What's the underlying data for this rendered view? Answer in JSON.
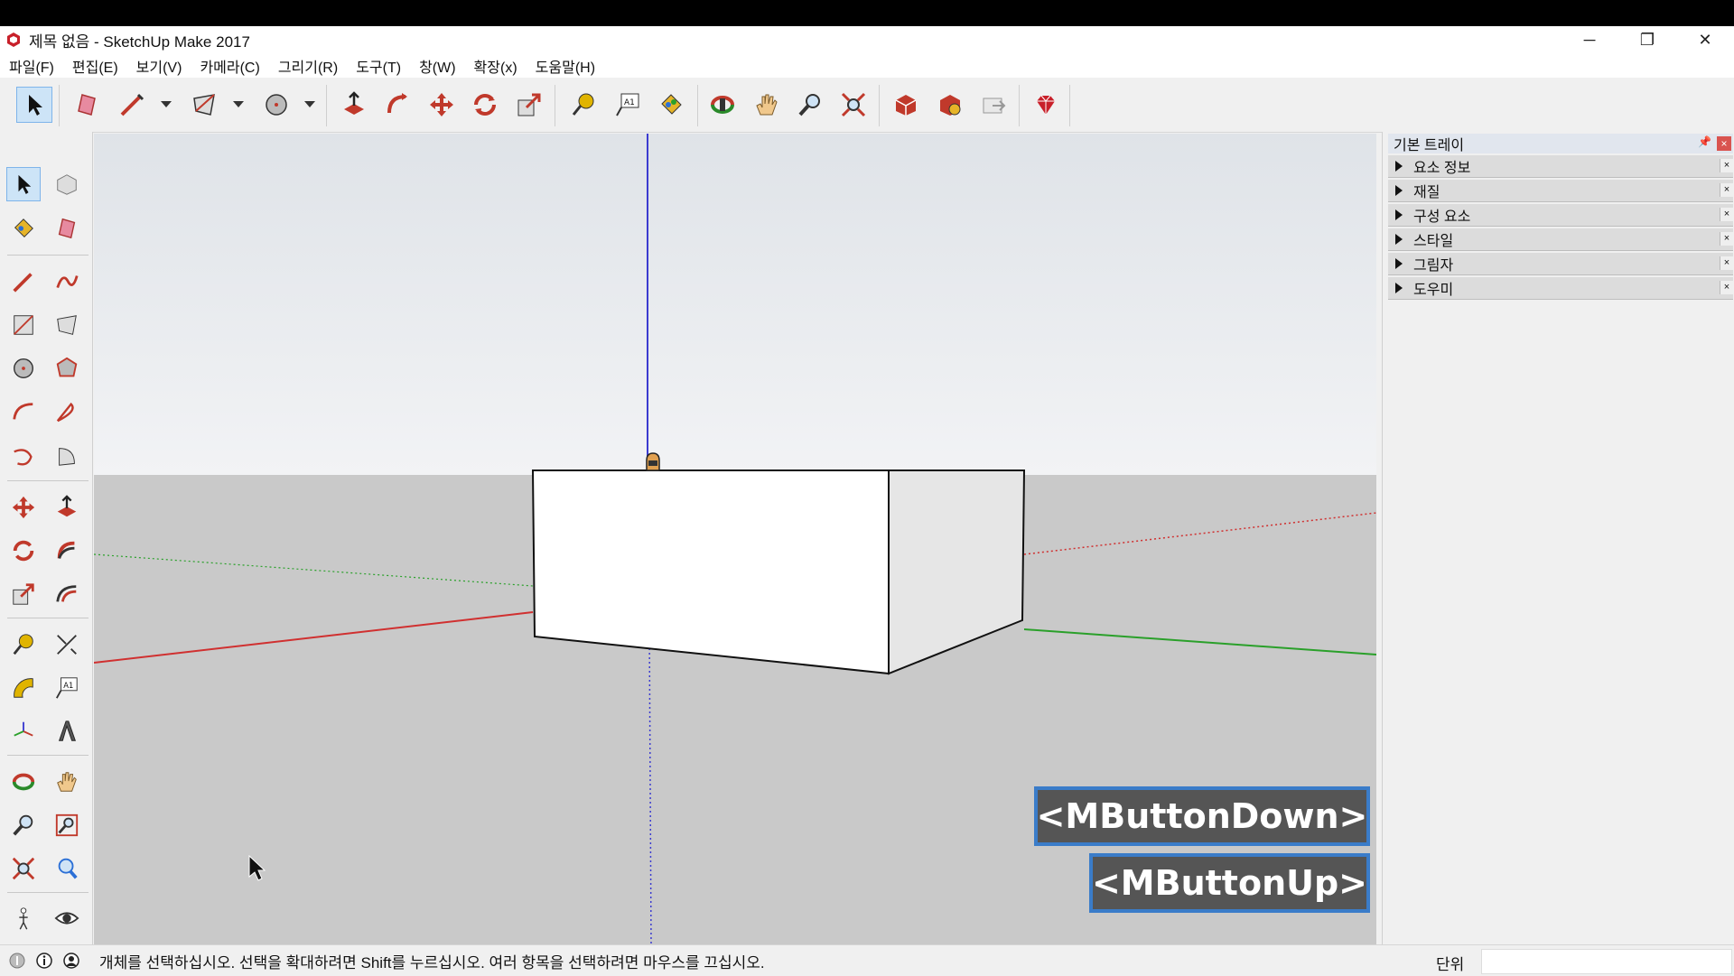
{
  "window": {
    "title": "제목 없음 - SketchUp Make 2017",
    "minimize": "─",
    "restore": "❐",
    "close": "✕"
  },
  "menu": {
    "items": [
      "파일(F)",
      "편집(E)",
      "보기(V)",
      "카메라(C)",
      "그리기(R)",
      "도구(T)",
      "창(W)",
      "확장(x)",
      "도움말(H)"
    ]
  },
  "tray": {
    "title": "기본 트레이",
    "panels": [
      "요소 정보",
      "재질",
      "구성 요소",
      "스타일",
      "그림자",
      "도우미"
    ],
    "pin": "📌",
    "close": "×"
  },
  "status": {
    "message": "개체를 선택하십시오. 선택을 확대하려면 Shift를 누르십시오. 여러 항목을 선택하려면 마우스를 끄십시오.",
    "units_label": "단위",
    "units_value": ""
  },
  "overlay": {
    "mbutton_down": "<MButtonDown>",
    "mbutton_up": "<MButtonUp>"
  },
  "colors": {
    "red_axis": "#d03030",
    "green_axis": "#2aa02a",
    "blue_axis": "#3b3bd0",
    "sky_top": "#dfe3e8",
    "sky_bottom": "#f2f3f5",
    "ground": "#c9c9c9",
    "overlay_border": "#3a7cc9",
    "overlay_bg": "#555555",
    "selected_tool": "#cde4f7"
  }
}
